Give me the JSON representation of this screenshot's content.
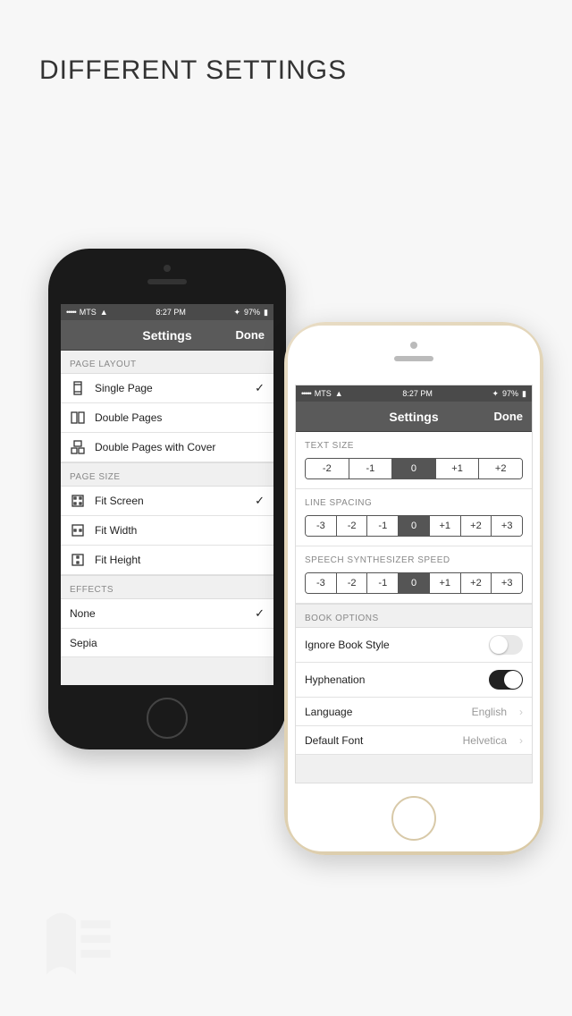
{
  "page": {
    "title": "DIFFERENT SETTINGS"
  },
  "status": {
    "carrier": "MTS",
    "time": "8:27 PM",
    "battery": "97%"
  },
  "nav": {
    "title": "Settings",
    "done": "Done"
  },
  "phone_black": {
    "sections": {
      "page_layout": {
        "header": "PAGE LAYOUT",
        "items": [
          {
            "label": "Single Page",
            "selected": true
          },
          {
            "label": "Double Pages",
            "selected": false
          },
          {
            "label": "Double Pages with Cover",
            "selected": false
          }
        ]
      },
      "page_size": {
        "header": "PAGE SIZE",
        "items": [
          {
            "label": "Fit Screen",
            "selected": true
          },
          {
            "label": "Fit Width",
            "selected": false
          },
          {
            "label": "Fit Height",
            "selected": false
          }
        ]
      },
      "effects": {
        "header": "EFFECTS",
        "items": [
          {
            "label": "None",
            "selected": true
          },
          {
            "label": "Sepia",
            "selected": false
          }
        ]
      }
    }
  },
  "phone_gold": {
    "text_size": {
      "header": "TEXT SIZE",
      "options": [
        "-2",
        "-1",
        "0",
        "+1",
        "+2"
      ],
      "selected": "0"
    },
    "line_spacing": {
      "header": "LINE SPACING",
      "options": [
        "-3",
        "-2",
        "-1",
        "0",
        "+1",
        "+2",
        "+3"
      ],
      "selected": "0"
    },
    "speech_speed": {
      "header": "SPEECH SYNTHESIZER SPEED",
      "options": [
        "-3",
        "-2",
        "-1",
        "0",
        "+1",
        "+2",
        "+3"
      ],
      "selected": "0"
    },
    "book_options": {
      "header": "BOOK OPTIONS",
      "ignore_style": {
        "label": "Ignore Book Style",
        "on": false
      },
      "hyphenation": {
        "label": "Hyphenation",
        "on": true
      },
      "language": {
        "label": "Language",
        "value": "English"
      },
      "default_font": {
        "label": "Default Font",
        "value": "Helvetica"
      }
    }
  }
}
